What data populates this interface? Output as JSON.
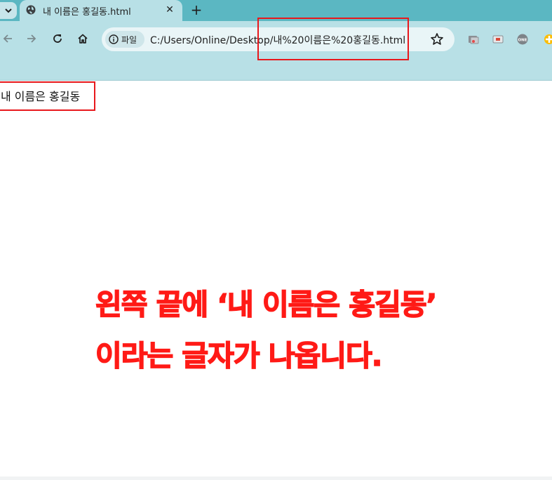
{
  "browser": {
    "tab": {
      "title": "내 이름은 홍길동.html",
      "close": "✕"
    },
    "new_tab": "+",
    "address_bar": {
      "chip_label": "파일",
      "url": "C:/Users/Online/Desktop/내%20이름은%20홍길동.html"
    },
    "colors": {
      "tabstrip": "#5bb7c2",
      "toolbar": "#b8e0e6",
      "annotation": "#e8181c"
    }
  },
  "page": {
    "body_text": "내 이름은 홍길동"
  },
  "annotation": {
    "line1": "왼쪽 끝에 ‘내 이름은 홍길동’",
    "line2": "이라는 글자가 나옵니다."
  }
}
